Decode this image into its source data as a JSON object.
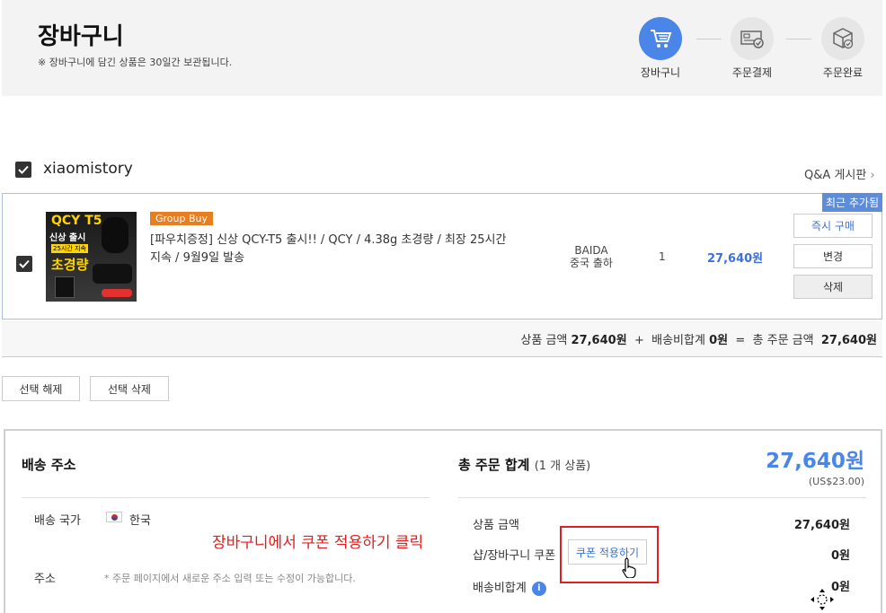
{
  "header": {
    "title": "장바구니",
    "note": "※ 장바구니에 담긴 상품은 30일간 보관됩니다.",
    "steps": [
      {
        "label": "장바구니",
        "icon": "cart-icon"
      },
      {
        "label": "주문결제",
        "icon": "payment-icon"
      },
      {
        "label": "주문완료",
        "icon": "box-check-icon"
      }
    ]
  },
  "seller": {
    "name": "xiaomistory",
    "qa_link": "Q&A 게시판"
  },
  "item": {
    "recent_badge": "최근 추가됨",
    "badge": "Group Buy",
    "name": "[파우치증정] 신상 QCY-T5 출시!! / QCY / 4.38g 초경량 / 최장 25시간 지속 / 9월9일 발송",
    "ship_from": "BAIDA",
    "ship_note": "중국 출하",
    "qty": "1",
    "price": "27,640원",
    "thumb_text": {
      "line1": "QCY T5",
      "line2": "신상 출시",
      "line3": "25시간 지속",
      "line4": "초경량"
    },
    "buttons": {
      "buy_now": "즉시 구매",
      "change": "변경",
      "delete": "삭제"
    }
  },
  "summary": {
    "product_label": "상품 금액",
    "product_amount": "27,640원",
    "plus": "+",
    "shipping_label": "배송비합계",
    "shipping_amount": "0원",
    "eq": "=",
    "total_label": "총 주문 금액",
    "total_amount": "27,640원"
  },
  "actions": {
    "deselect": "선택 해제",
    "delete_selected": "선택 삭제"
  },
  "address": {
    "heading": "배송 주소",
    "country_label": "배송 국가",
    "country": "한국",
    "address_label": "주소",
    "address_hint": "* 주문 페이지에서 새로운 주소 입력 또는 수정이 가능합니다."
  },
  "totals": {
    "heading": "총 주문 합계",
    "count": "(1 개 상품)",
    "total": "27,640원",
    "usd": "(US$23.00)",
    "product_label": "상품 금액",
    "product_value": "27,640원",
    "coupon_label": "샵/장바구니 쿠폰",
    "coupon_button": "쿠폰 적용하기",
    "coupon_value": "0원",
    "shipping_label": "배송비합계",
    "shipping_value": "0원"
  },
  "annotation": "장바구니에서 쿠폰 적용하기 클릭",
  "colors": {
    "accent": "#4a86e8",
    "annotation": "#e02020",
    "badge": "#e67e22"
  }
}
